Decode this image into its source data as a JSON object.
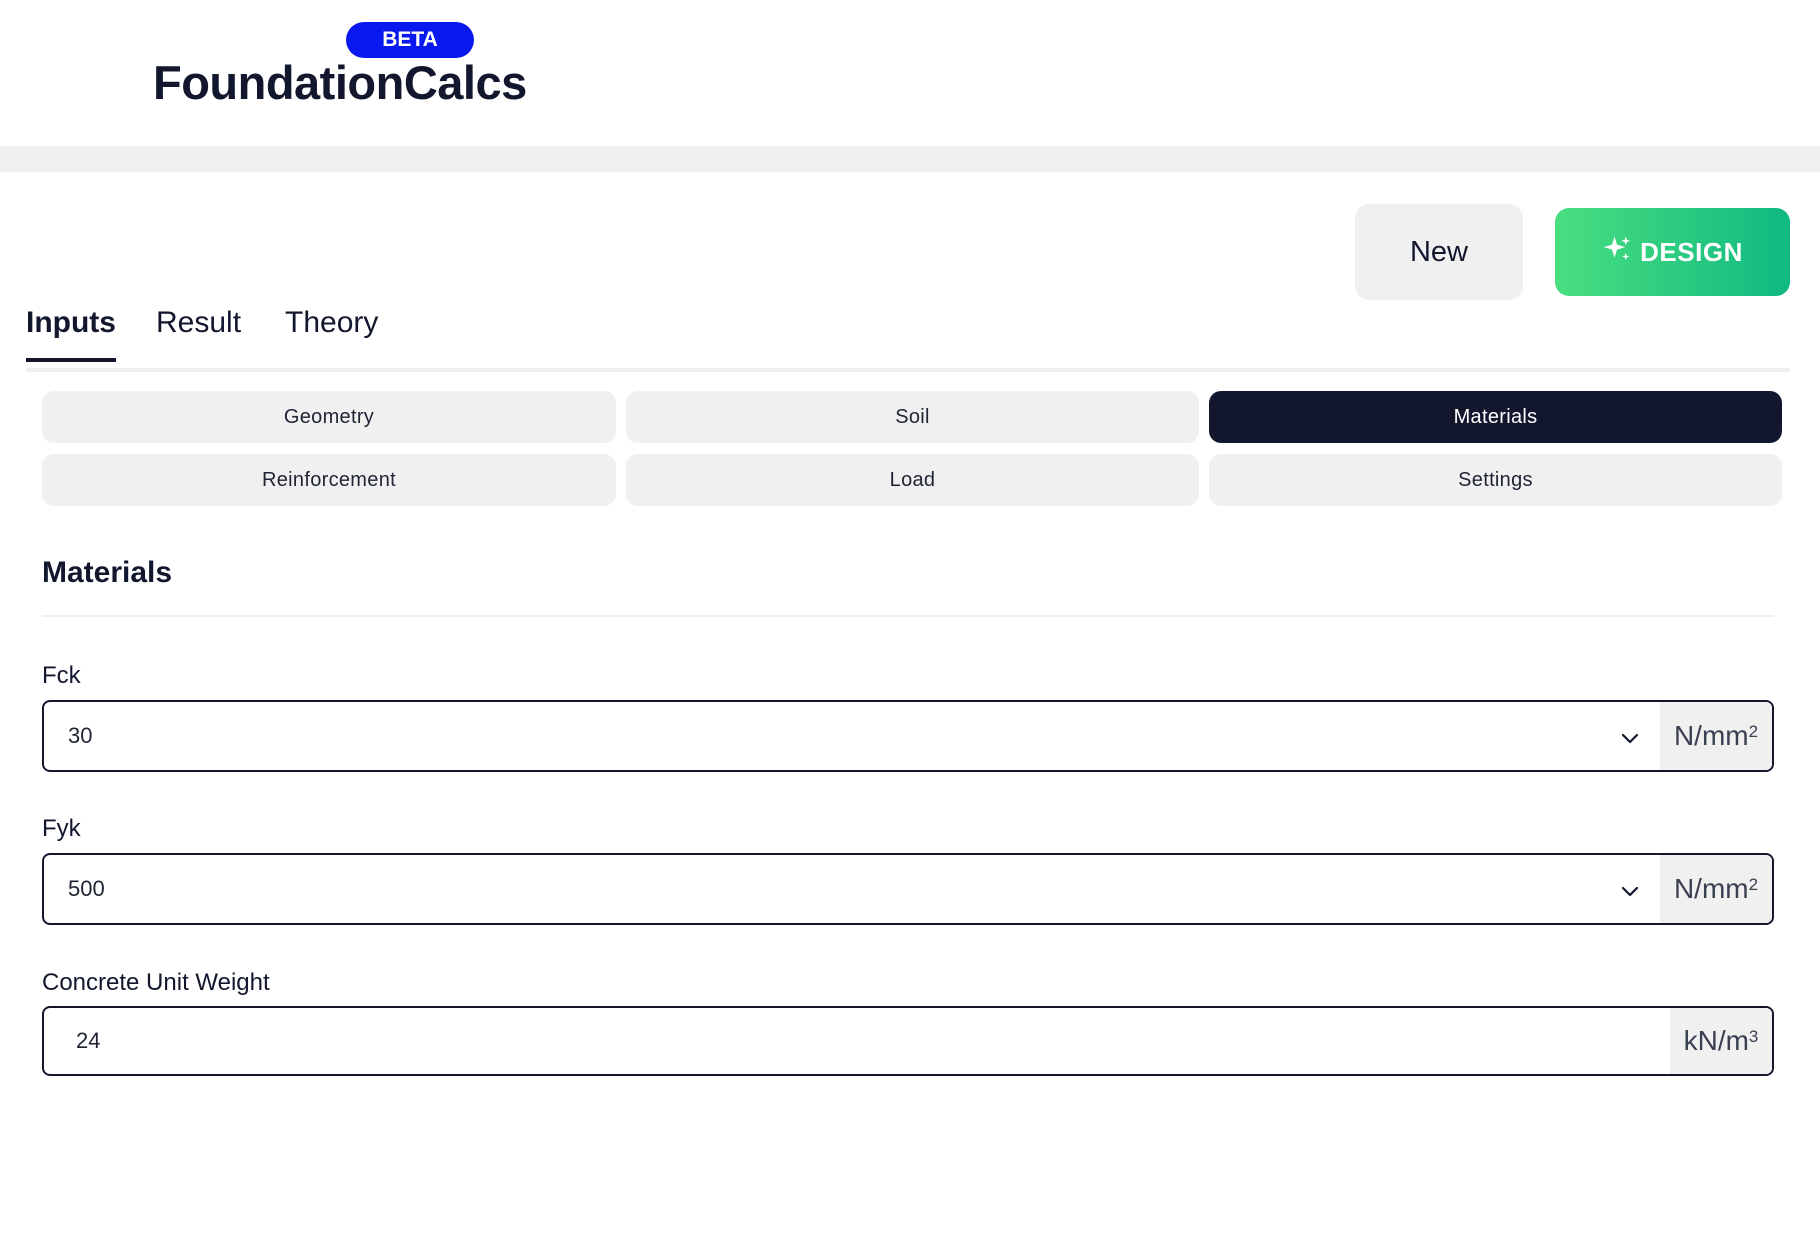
{
  "header": {
    "logo_text": "FoundationCalcs",
    "beta_badge": "BETA"
  },
  "actions": {
    "new_label": "New",
    "design_label": "DESIGN"
  },
  "tabs": [
    {
      "label": "Inputs",
      "active": true
    },
    {
      "label": "Result",
      "active": false
    },
    {
      "label": "Theory",
      "active": false
    }
  ],
  "subtabs": [
    {
      "label": "Geometry",
      "active": false
    },
    {
      "label": "Soil",
      "active": false
    },
    {
      "label": "Materials",
      "active": true
    },
    {
      "label": "Reinforcement",
      "active": false
    },
    {
      "label": "Load",
      "active": false
    },
    {
      "label": "Settings",
      "active": false
    }
  ],
  "section": {
    "title": "Materials"
  },
  "fields": {
    "fck": {
      "label": "Fck",
      "value": "30",
      "unit": "N/mm",
      "unit_exp": "2"
    },
    "fyk": {
      "label": "Fyk",
      "value": "500",
      "unit": "N/mm",
      "unit_exp": "2"
    },
    "unit_weight": {
      "label": "Concrete Unit Weight",
      "value": "24",
      "unit": "kN/m",
      "unit_exp": "3"
    }
  },
  "colors": {
    "brand_dark": "#12172e",
    "beta_blue": "#0a18f0",
    "design_green_start": "#4ade80",
    "design_green_end": "#10b981",
    "neutral_bg": "#f0f0f0"
  }
}
